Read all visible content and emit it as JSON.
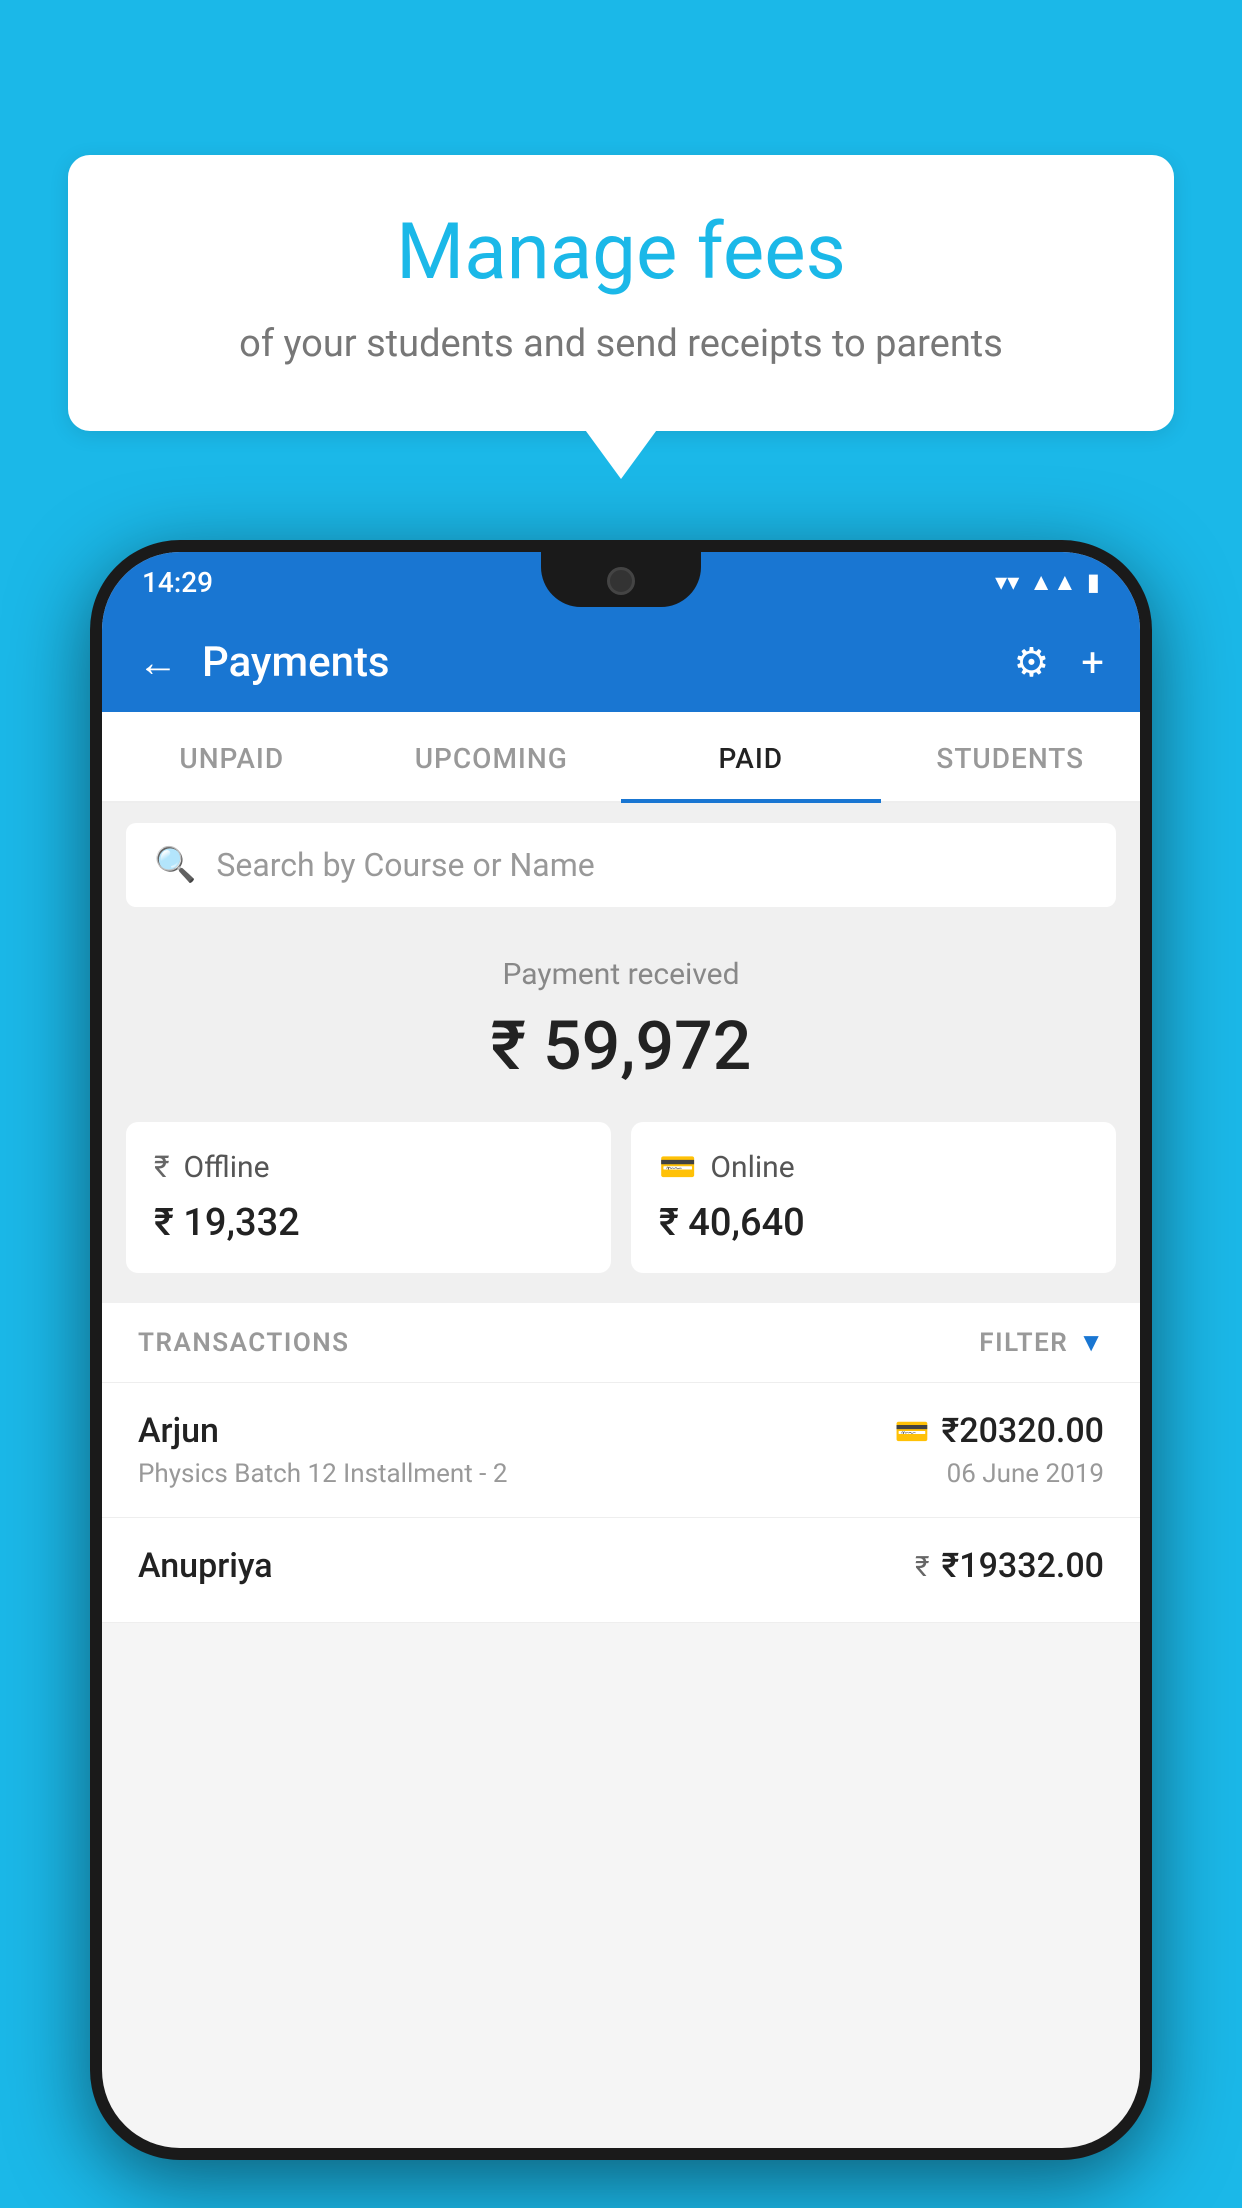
{
  "page": {
    "background_color": "#1BB8E8"
  },
  "bubble": {
    "title": "Manage fees",
    "subtitle": "of your students and send receipts to parents"
  },
  "status_bar": {
    "time": "14:29",
    "wifi_icon": "▾",
    "signal_icon": "▲",
    "battery_icon": "▮"
  },
  "app_bar": {
    "title": "Payments",
    "back_label": "←",
    "settings_label": "⚙",
    "add_label": "+"
  },
  "tabs": [
    {
      "label": "UNPAID",
      "active": false
    },
    {
      "label": "UPCOMING",
      "active": false
    },
    {
      "label": "PAID",
      "active": true
    },
    {
      "label": "STUDENTS",
      "active": false
    }
  ],
  "search": {
    "placeholder": "Search by Course or Name"
  },
  "payment_summary": {
    "label": "Payment received",
    "amount": "₹ 59,972",
    "offline_label": "Offline",
    "offline_amount": "₹ 19,332",
    "online_label": "Online",
    "online_amount": "₹ 40,640"
  },
  "transactions": {
    "section_label": "TRANSACTIONS",
    "filter_label": "FILTER",
    "items": [
      {
        "name": "Arjun",
        "detail": "Physics Batch 12 Installment - 2",
        "amount": "₹20320.00",
        "date": "06 June 2019",
        "payment_type": "card"
      },
      {
        "name": "Anupriya",
        "detail": "",
        "amount": "₹19332.00",
        "date": "",
        "payment_type": "cash"
      }
    ]
  }
}
